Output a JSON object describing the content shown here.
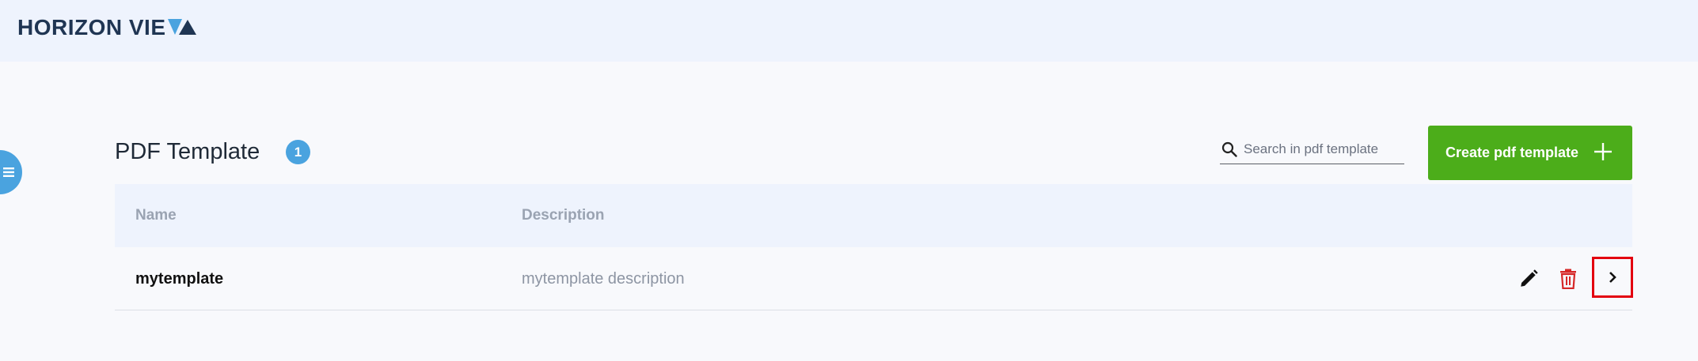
{
  "header": {
    "logo_text": "HORIZON VIE"
  },
  "page": {
    "title": "PDF Template",
    "count": "1"
  },
  "search": {
    "placeholder": "Search in pdf template",
    "value": ""
  },
  "toolbar": {
    "create_label": "Create pdf template"
  },
  "table": {
    "columns": [
      "Name",
      "Description"
    ],
    "rows": [
      {
        "name": "mytemplate",
        "description": "mytemplate description"
      }
    ]
  },
  "icons": {
    "menu": "hamburger-menu-icon",
    "search": "search-icon",
    "plus": "plus-icon",
    "edit": "pencil-icon",
    "delete": "trash-icon",
    "open": "chevron-right-icon"
  },
  "colors": {
    "brand_dark": "#1f3553",
    "accent_blue": "#4aa3df",
    "create_green": "#4cad1a",
    "delete_red": "#d62828",
    "highlight_red": "#e3000f"
  }
}
